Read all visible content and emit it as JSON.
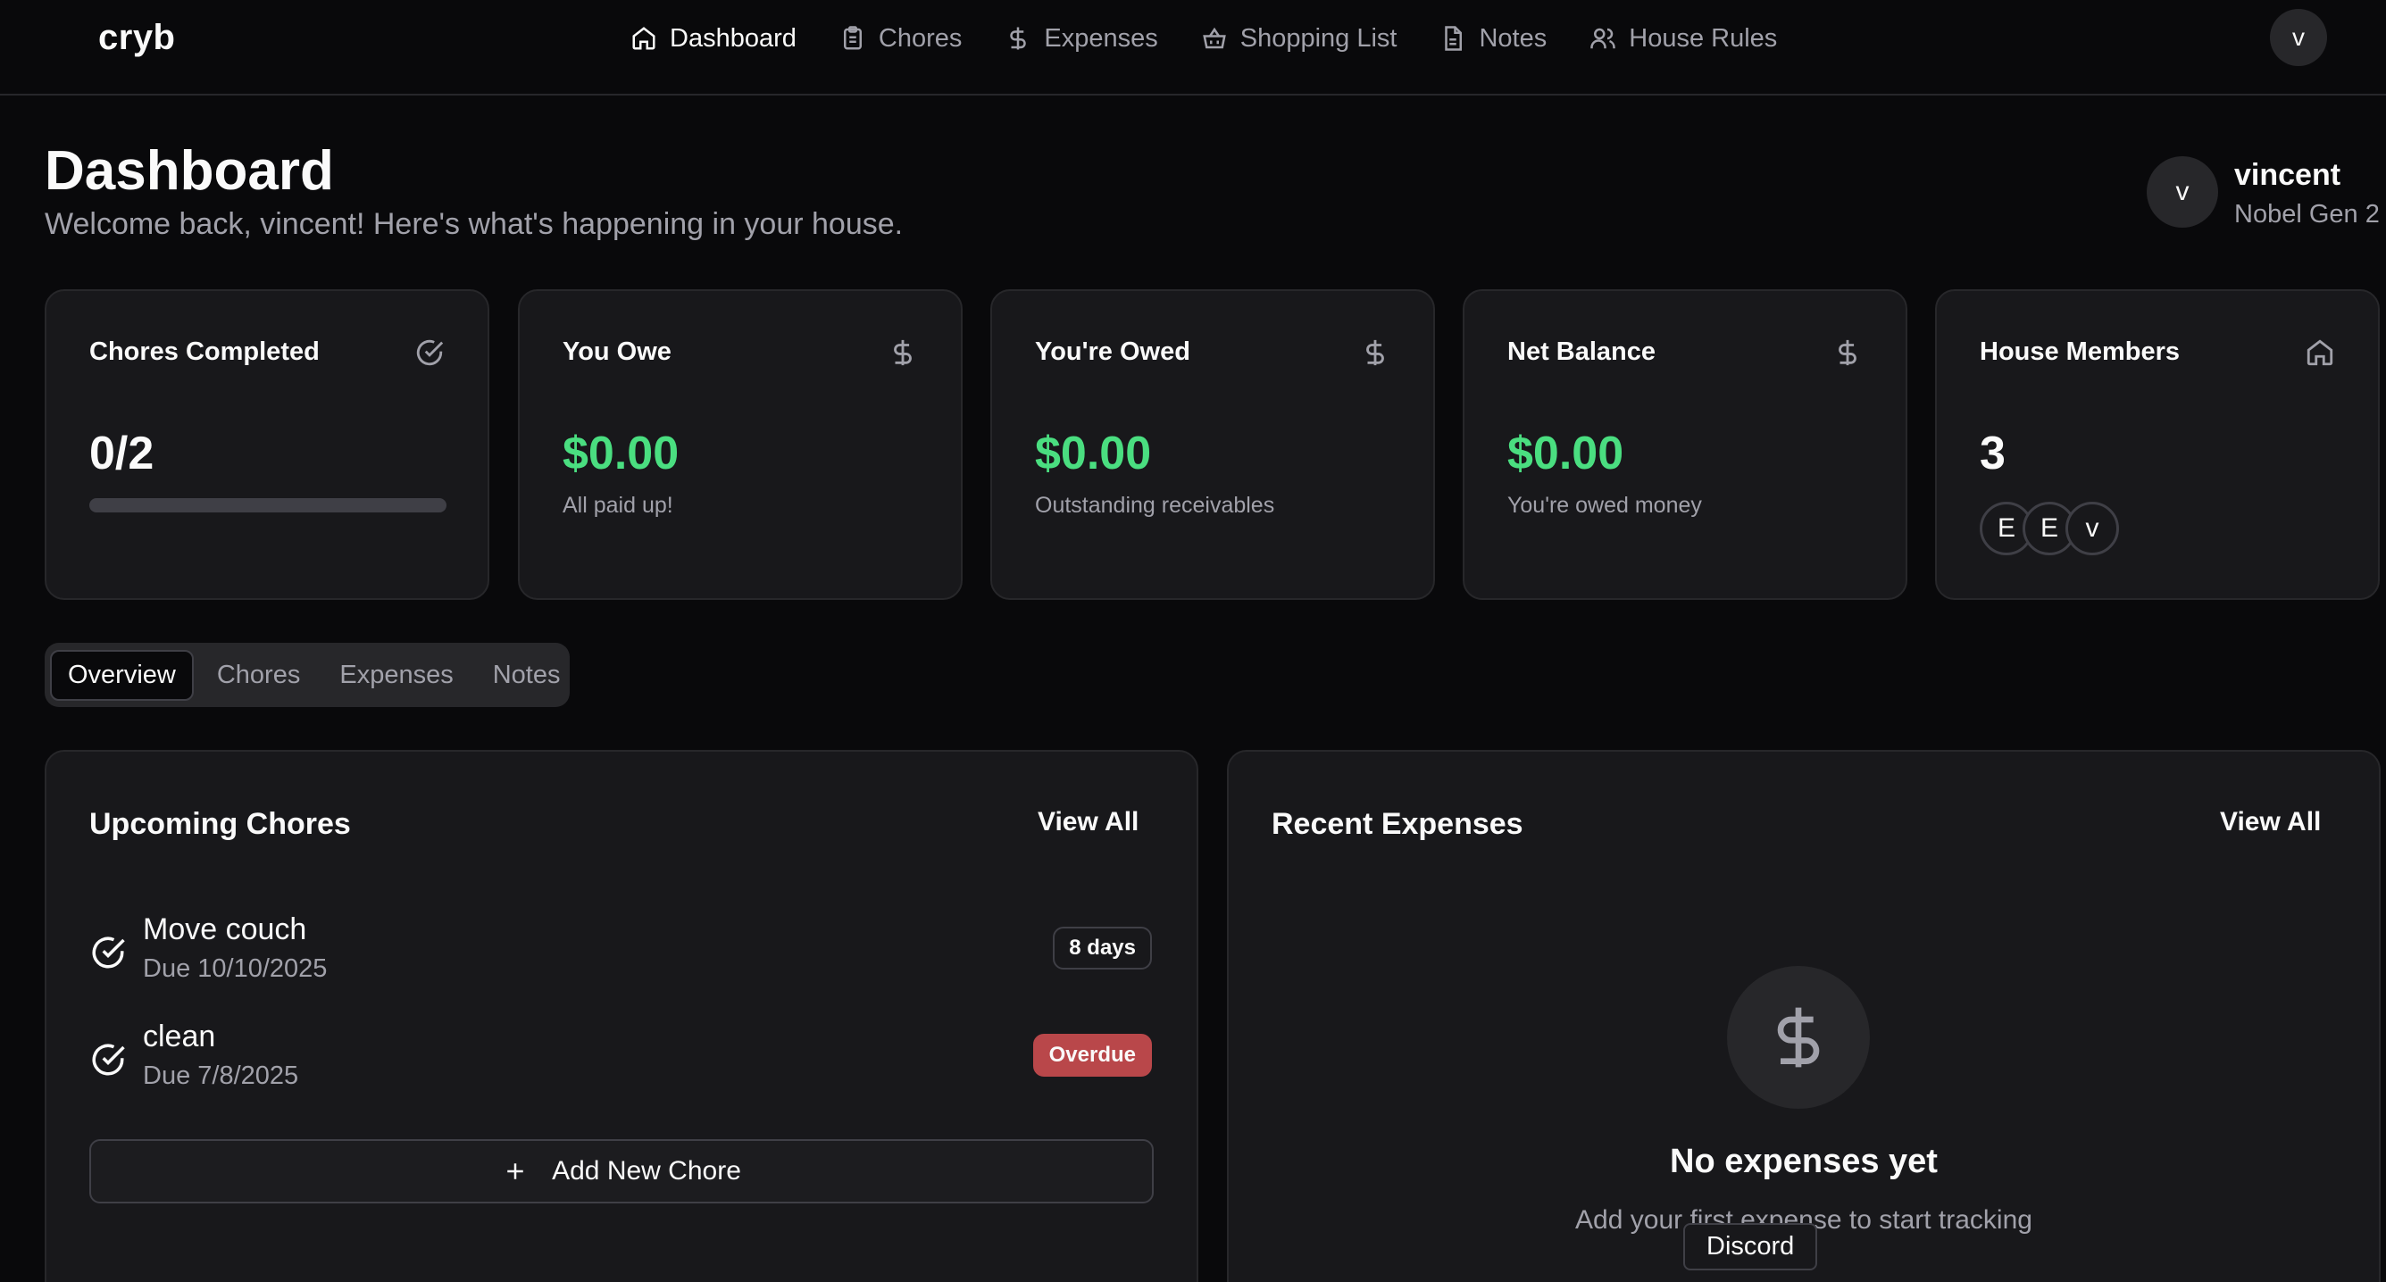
{
  "app": {
    "name": "cryb"
  },
  "nav": {
    "items": [
      {
        "label": "Dashboard",
        "icon": "home-icon",
        "active": true
      },
      {
        "label": "Chores",
        "icon": "clipboard-icon"
      },
      {
        "label": "Expenses",
        "icon": "dollar-icon"
      },
      {
        "label": "Shopping List",
        "icon": "basket-icon"
      },
      {
        "label": "Notes",
        "icon": "file-icon"
      },
      {
        "label": "House Rules",
        "icon": "users-icon"
      }
    ],
    "avatar": "v"
  },
  "header": {
    "title": "Dashboard",
    "subtitle": "Welcome back, vincent! Here's what's happening in your house.",
    "user": {
      "avatar": "v",
      "name": "vincent",
      "house": "Nobel Gen 2"
    }
  },
  "stats": {
    "chores": {
      "title": "Chores Completed",
      "value": "0/2",
      "progress": 0,
      "icon": "check-circle-icon"
    },
    "owe": {
      "title": "You Owe",
      "value": "$0.00",
      "caption": "All paid up!",
      "icon": "dollar-icon"
    },
    "owed": {
      "title": "You're Owed",
      "value": "$0.00",
      "caption": "Outstanding receivables",
      "icon": "dollar-icon"
    },
    "net": {
      "title": "Net Balance",
      "value": "$0.00",
      "caption": "You're owed money",
      "icon": "dollar-icon"
    },
    "members": {
      "title": "House Members",
      "value": "3",
      "initials": [
        "E",
        "E",
        "v"
      ],
      "icon": "home-icon"
    }
  },
  "tabs": [
    {
      "label": "Overview",
      "active": true
    },
    {
      "label": "Chores"
    },
    {
      "label": "Expenses"
    },
    {
      "label": "Notes"
    }
  ],
  "upcoming": {
    "title": "Upcoming Chores",
    "view_all": "View All",
    "items": [
      {
        "name": "Move couch",
        "due": "Due 10/10/2025",
        "badge": "8 days",
        "status": "normal"
      },
      {
        "name": "clean",
        "due": "Due 7/8/2025",
        "badge": "Overdue",
        "status": "overdue"
      }
    ],
    "add_label": "Add New Chore"
  },
  "expenses": {
    "title": "Recent Expenses",
    "view_all": "View All",
    "empty_title": "No expenses yet",
    "empty_sub": "Add your first expense to start tracking"
  },
  "tooltip": "Discord",
  "colors": {
    "background": "#09090b",
    "card": "#18181b",
    "green": "#4ade80",
    "overdue": "#b9474a"
  }
}
